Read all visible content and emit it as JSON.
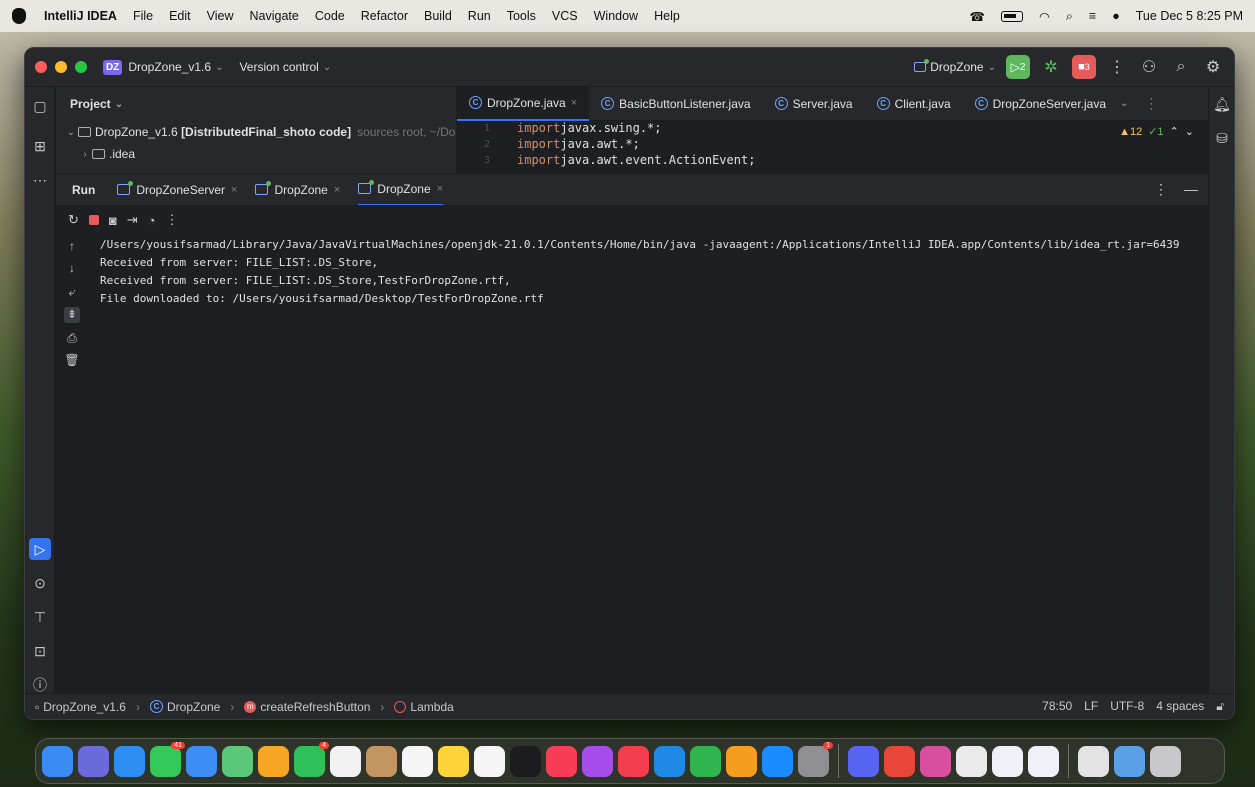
{
  "menubar": {
    "app_name": "IntelliJ IDEA",
    "items": [
      "File",
      "Edit",
      "View",
      "Navigate",
      "Code",
      "Refactor",
      "Build",
      "Run",
      "Tools",
      "VCS",
      "Window",
      "Help"
    ],
    "clock": "Tue Dec 5  8:25 PM"
  },
  "titlebar": {
    "project_badge": "DZ",
    "project_name": "DropZone_v1.6",
    "vcs": "Version control",
    "run_config": "DropZone",
    "run_badge": "2",
    "stop_badge": "3"
  },
  "project": {
    "header": "Project",
    "root_name": "DropZone_v1.6",
    "root_module": "[DistributedFinal_shoto code]",
    "root_hint": "sources root, ~/Do",
    "child": ".idea"
  },
  "editor": {
    "tabs": [
      "DropZone.java",
      "BasicButtonListener.java",
      "Server.java",
      "Client.java",
      "DropZoneServer.java"
    ],
    "lines": [
      {
        "num": "1",
        "kw": "import",
        "rest": " javax.swing.*;"
      },
      {
        "num": "2",
        "kw": "import",
        "rest": " java.awt.*;"
      },
      {
        "num": "3",
        "kw": "import",
        "rest": " java.awt.event.ActionEvent;"
      }
    ],
    "warnings": "▲12",
    "checks": "✓1"
  },
  "run": {
    "title": "Run",
    "tabs": [
      "DropZoneServer",
      "DropZone",
      "DropZone"
    ],
    "console": [
      "/Users/yousifsarmad/Library/Java/JavaVirtualMachines/openjdk-21.0.1/Contents/Home/bin/java -javaagent:/Applications/IntelliJ IDEA.app/Contents/lib/idea_rt.jar=6439",
      "Received from server: FILE_LIST:.DS_Store,",
      "Received from server: FILE_LIST:.DS_Store,TestForDropZone.rtf,",
      "File downloaded to: /Users/yousifsarmad/Desktop/TestForDropZone.rtf"
    ]
  },
  "statusbar": {
    "crumbs": [
      "DropZone_v1.6",
      "DropZone",
      "createRefreshButton",
      "Lambda"
    ],
    "position": "78:50",
    "line_sep": "LF",
    "encoding": "UTF-8",
    "indent": "4 spaces"
  },
  "dock": {
    "apps": [
      {
        "name": "finder",
        "color": "#3b8bf5"
      },
      {
        "name": "launchpad",
        "color": "#6b6bdb"
      },
      {
        "name": "safari",
        "color": "#2b8ef0"
      },
      {
        "name": "messages",
        "color": "#34c759",
        "badge": "41"
      },
      {
        "name": "mail",
        "color": "#3d8df5"
      },
      {
        "name": "maps",
        "color": "#5ac878"
      },
      {
        "name": "photos",
        "color": "#f6a623"
      },
      {
        "name": "facetime",
        "color": "#30c05a",
        "badge": "4"
      },
      {
        "name": "calendar",
        "color": "#f2f2f2"
      },
      {
        "name": "contacts",
        "color": "#c39560"
      },
      {
        "name": "reminders",
        "color": "#f5f5f5"
      },
      {
        "name": "notes",
        "color": "#ffd43b"
      },
      {
        "name": "freeform",
        "color": "#f5f5f5"
      },
      {
        "name": "tv",
        "color": "#1c1c1e"
      },
      {
        "name": "music",
        "color": "#fa3d56"
      },
      {
        "name": "podcasts",
        "color": "#a64ce8"
      },
      {
        "name": "news",
        "color": "#f33d4e"
      },
      {
        "name": "keynote",
        "color": "#1e88e5"
      },
      {
        "name": "numbers",
        "color": "#30b44e"
      },
      {
        "name": "pages",
        "color": "#f59d1f"
      },
      {
        "name": "app-store",
        "color": "#1a8cff"
      },
      {
        "name": "system-settings",
        "color": "#8e8e93",
        "badge": "1"
      },
      {
        "name": "discord",
        "color": "#5865f2"
      },
      {
        "name": "chrome",
        "color": "#e9463a"
      },
      {
        "name": "intellij",
        "color": "#d94fa0"
      },
      {
        "name": "textedit",
        "color": "#eaeaea"
      },
      {
        "name": "java-app-1",
        "color": "#eef1f7"
      },
      {
        "name": "java-app-2",
        "color": "#eef1f7"
      },
      {
        "name": "documents",
        "color": "#e3e3e3"
      },
      {
        "name": "downloads",
        "color": "#5aa0e6"
      },
      {
        "name": "trash",
        "color": "#c7c7cc"
      }
    ]
  }
}
